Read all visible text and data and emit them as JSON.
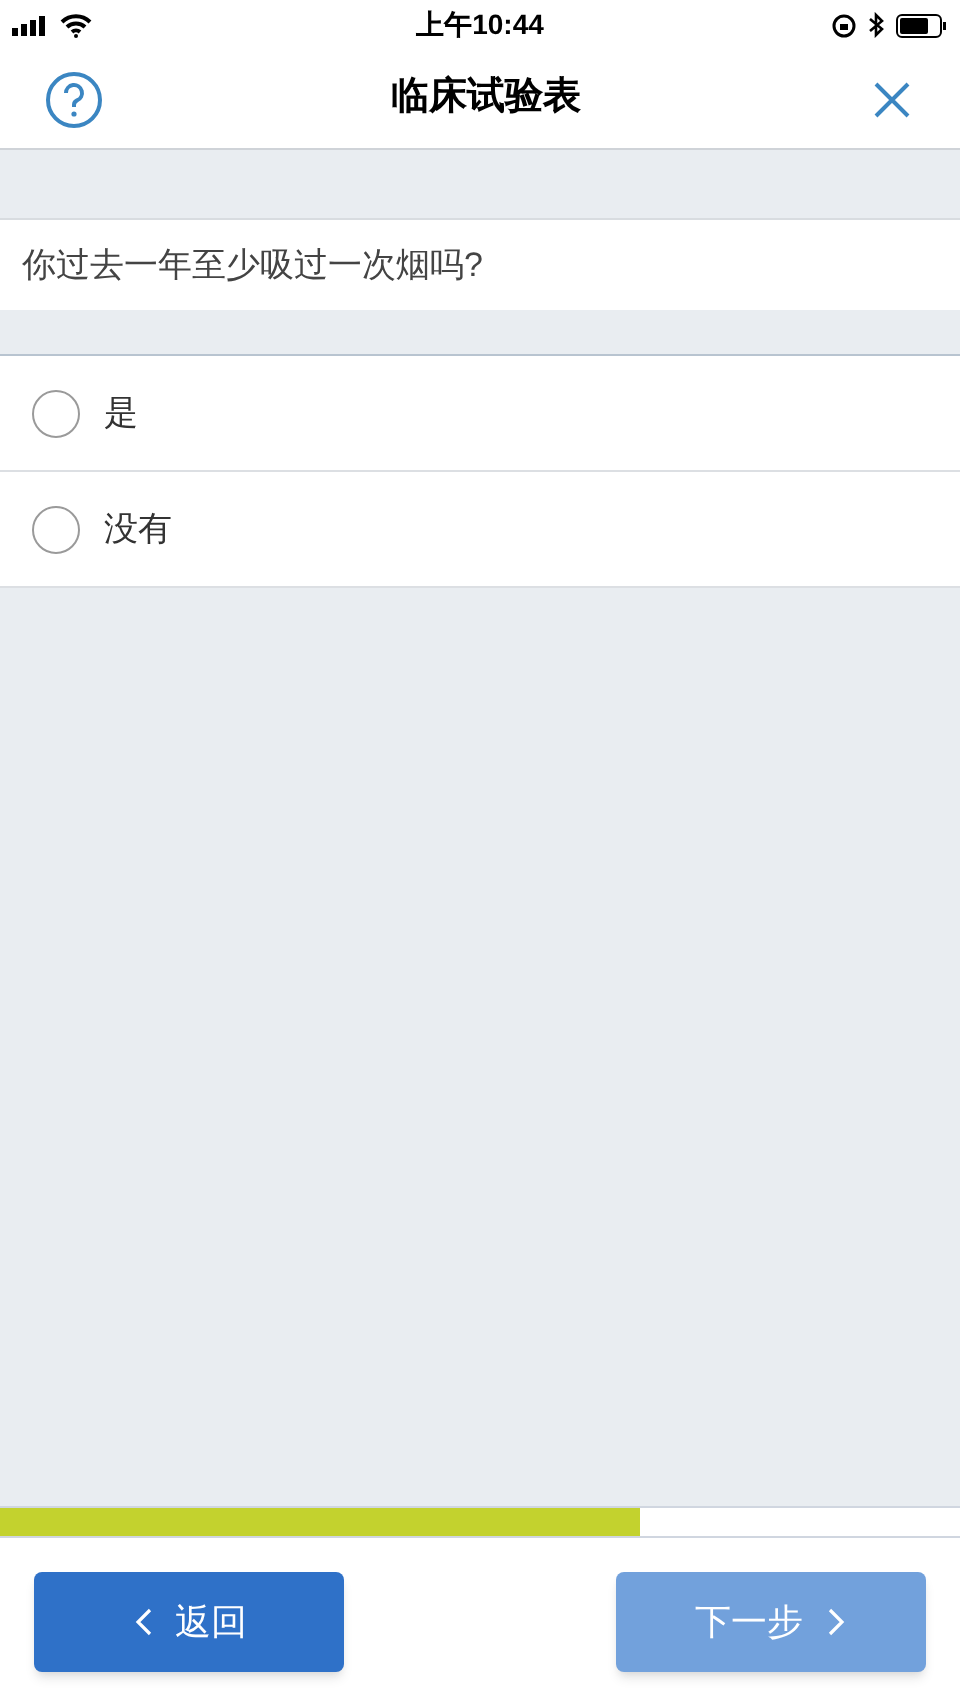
{
  "status_bar": {
    "time": "上午10:44"
  },
  "header": {
    "title": "临床试验表"
  },
  "question": {
    "text": "你过去一年至少吸过一次烟吗?"
  },
  "options": [
    {
      "label": "是",
      "selected": false
    },
    {
      "label": "没有",
      "selected": false
    }
  ],
  "progress": {
    "level": 0.667
  },
  "buttons": [
    {
      "label": "返回",
      "kind": "back",
      "disabled": false
    },
    {
      "label": "下一步",
      "kind": "next",
      "disabled": true
    }
  ]
}
